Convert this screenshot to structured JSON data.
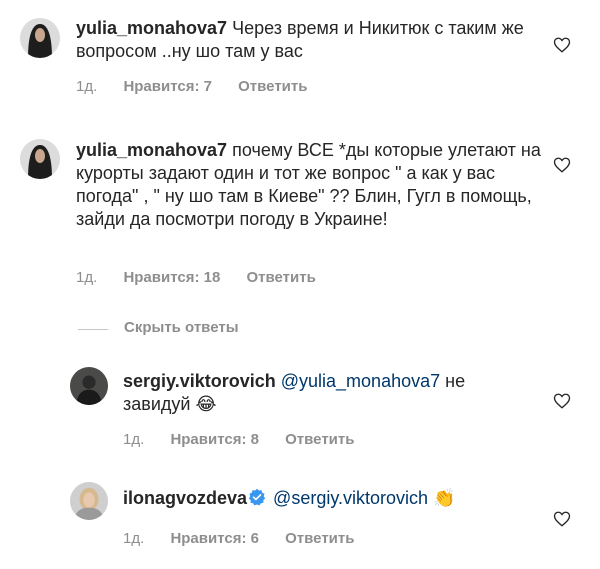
{
  "comments": [
    {
      "username": "yulia_monahova7",
      "text": "Через время и Никитюк с таким же вопросом ..ну шо там у вас",
      "time": "1д.",
      "likes": "Нравится: 7",
      "reply": "Ответить",
      "avatar": "avatar-dark-hair-icon"
    },
    {
      "username": "yulia_monahova7",
      "text": "почему ВСЕ *ды которые улетают на курорты задают один и тот же вопрос \" а как у вас погода\" , \" ну шо там в Киеве\" ?? Блин, Гугл в помощь, зайди да посмотри погоду в Украине!",
      "time": "1д.",
      "likes": "Нравится: 18",
      "reply": "Ответить",
      "avatar": "avatar-dark-hair-icon"
    }
  ],
  "hide_replies": "Скрыть ответы",
  "replies": [
    {
      "username": "sergiy.viktorovich",
      "mention": "@yulia_monahova7",
      "text": "не завидуй",
      "emoji": "😂",
      "time": "1д.",
      "likes": "Нравится: 8",
      "reply": "Ответить"
    },
    {
      "username": "ilonagvozdeva",
      "verified": true,
      "mention": "@sergiy.viktorovich",
      "emoji": "👏",
      "time": "1д.",
      "likes": "Нравится: 6",
      "reply": "Ответить"
    }
  ],
  "colors": {
    "text": "#262626",
    "meta": "#8e8e8e",
    "mention": "#00376b",
    "verified": "#3897f0"
  }
}
